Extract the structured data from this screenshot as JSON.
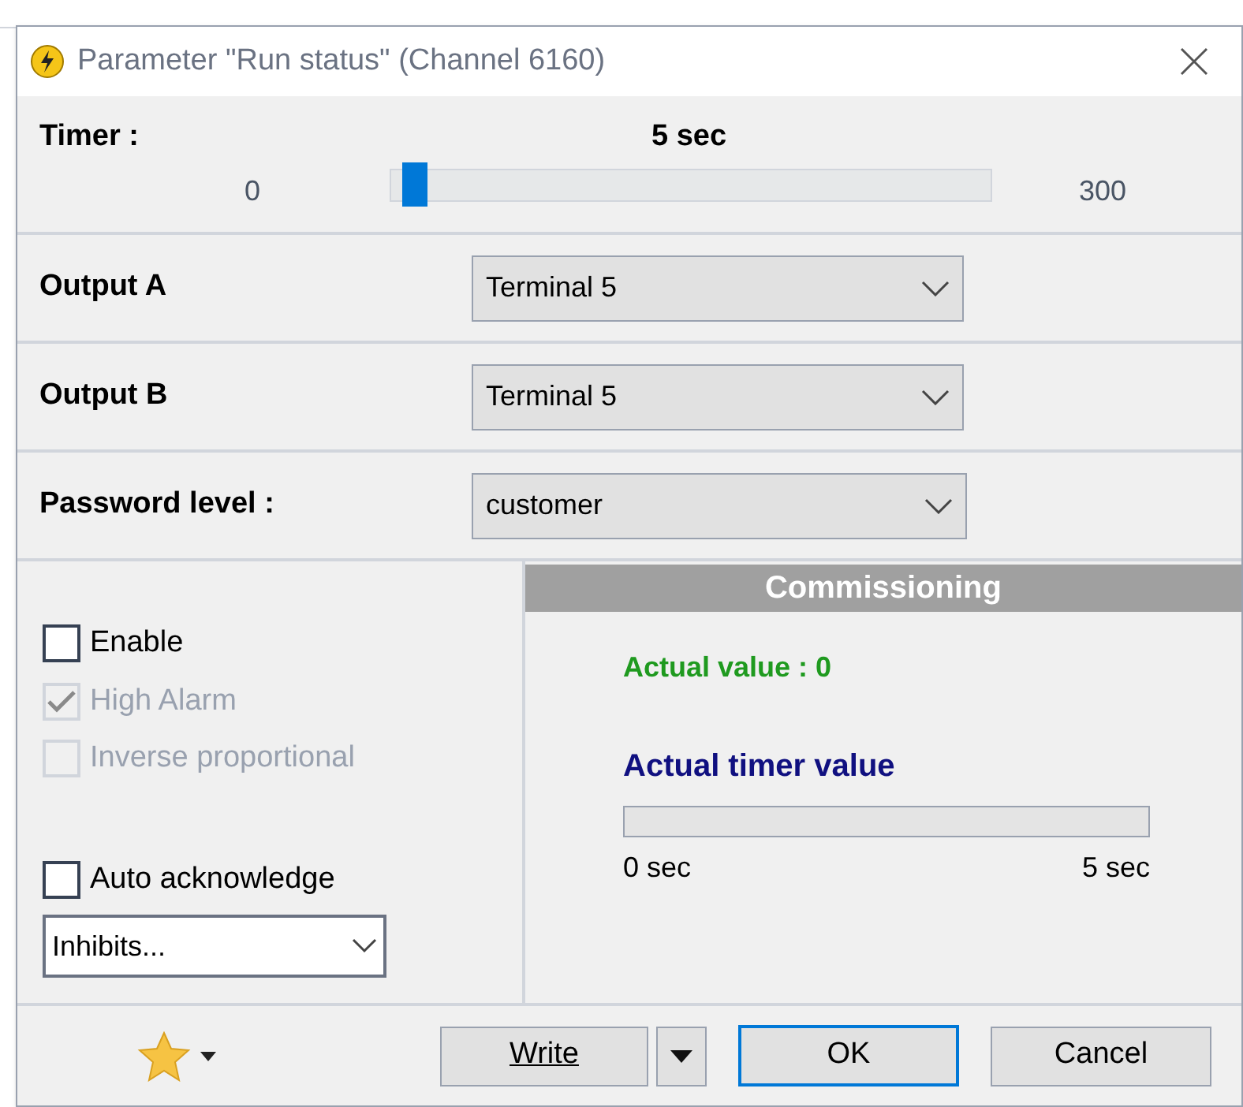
{
  "window": {
    "title": "Parameter \"Run status\" (Channel 6160)"
  },
  "timer": {
    "label": "Timer :",
    "value": "5 sec",
    "min": "0",
    "max": "300",
    "level": 0.017
  },
  "fields": [
    {
      "label": "Output A",
      "value": "Terminal 5"
    },
    {
      "label": "Output B",
      "value": "Terminal 5"
    },
    {
      "label": "Password level :",
      "value": "customer"
    }
  ],
  "options": [
    {
      "label": "Enable",
      "checked": false,
      "disabled": false
    },
    {
      "label": "High Alarm",
      "checked": true,
      "disabled": true
    },
    {
      "label": "Inverse proportional",
      "checked": false,
      "disabled": true
    }
  ],
  "auto_acknowledge": {
    "label": "Auto acknowledge",
    "checked": false
  },
  "inhibits": {
    "value": "Inhibits..."
  },
  "commissioning": {
    "title": "Commissioning",
    "actual_value": "Actual value : 0",
    "timer_title": "Actual timer value",
    "level": 0,
    "min": "0 sec",
    "max": "5 sec"
  },
  "buttons": {
    "write": "Write",
    "ok": "OK",
    "cancel": "Cancel"
  }
}
